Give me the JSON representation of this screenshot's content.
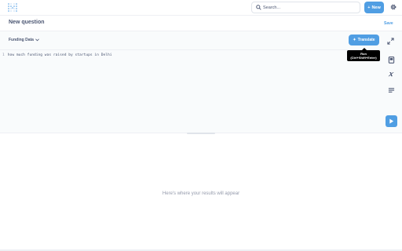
{
  "topbar": {
    "search_placeholder": "Search...",
    "new_label": "New"
  },
  "question": {
    "title": "New question",
    "save_label": "Save"
  },
  "editor": {
    "database": "Funding Data",
    "translate_label": "Translate",
    "line_number": "1",
    "query_text": "how much funding was raised by startups in Delhi",
    "tooltip_line1": "Run",
    "tooltip_line2": "(Ctrl+Shift+Enter)"
  },
  "results": {
    "empty_message": "Here's where your results will appear"
  },
  "colors": {
    "accent": "#509ee3",
    "text": "#4c5773",
    "muted": "#949aab"
  },
  "icons": [
    "metabase-logo-icon",
    "search-icon",
    "plus-icon",
    "gear-icon",
    "chevron-down-icon",
    "sparkle-icon",
    "collapse-icon",
    "book-icon",
    "variable-icon",
    "snippet-icon",
    "play-icon"
  ]
}
